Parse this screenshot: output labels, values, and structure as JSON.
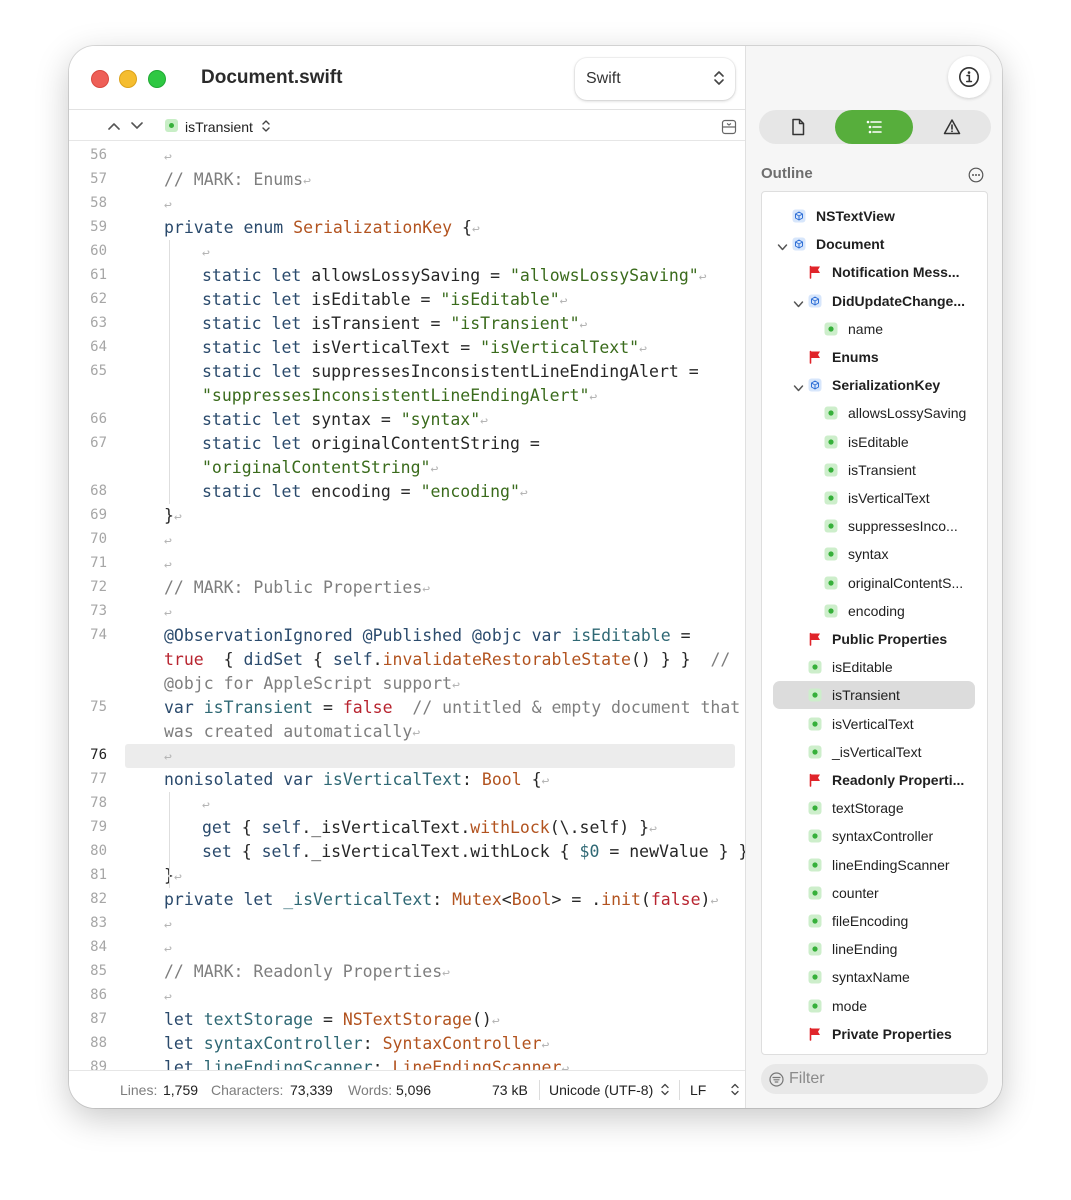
{
  "window": {
    "title": "Document.swift",
    "language": "Swift"
  },
  "jump_bar": {
    "symbol": "isTransient"
  },
  "colors": {
    "keyword": "#2a4a6c",
    "type": "#b2531f",
    "string": "#3a6b1c",
    "comment": "#7e7e7e",
    "member": "#2f6874",
    "literal": "#b8242f",
    "accent": "#57ae3c"
  },
  "code": {
    "current_line": "76",
    "lines": [
      {
        "n": "56",
        "indent": 1,
        "segs": [
          {
            "c": "i",
            "t": "↩"
          }
        ]
      },
      {
        "n": "57",
        "indent": 1,
        "segs": [
          {
            "c": "c",
            "t": "// MARK: Enums"
          },
          {
            "c": "i",
            "t": "↩"
          }
        ]
      },
      {
        "n": "58",
        "indent": 1,
        "segs": [
          {
            "c": "i",
            "t": "↩"
          }
        ]
      },
      {
        "n": "59",
        "indent": 1,
        "segs": [
          {
            "c": "k",
            "t": "private enum "
          },
          {
            "c": "ty",
            "t": "SerializationKey"
          },
          {
            "c": "p",
            "t": " {"
          },
          {
            "c": "i",
            "t": "↩"
          }
        ]
      },
      {
        "n": "60",
        "indent": 2,
        "segs": [
          {
            "c": "i",
            "t": "↩"
          }
        ]
      },
      {
        "n": "61",
        "indent": 2,
        "segs": [
          {
            "c": "k",
            "t": "static let "
          },
          {
            "c": "p",
            "t": "allowsLossySaving = "
          },
          {
            "c": "s",
            "t": "\"allowsLossySaving\""
          },
          {
            "c": "i",
            "t": "↩"
          }
        ]
      },
      {
        "n": "62",
        "indent": 2,
        "segs": [
          {
            "c": "k",
            "t": "static let "
          },
          {
            "c": "p",
            "t": "isEditable = "
          },
          {
            "c": "s",
            "t": "\"isEditable\""
          },
          {
            "c": "i",
            "t": "↩"
          }
        ]
      },
      {
        "n": "63",
        "indent": 2,
        "segs": [
          {
            "c": "k",
            "t": "static let "
          },
          {
            "c": "p",
            "t": "isTransient = "
          },
          {
            "c": "s",
            "t": "\"isTransient\""
          },
          {
            "c": "i",
            "t": "↩"
          }
        ]
      },
      {
        "n": "64",
        "indent": 2,
        "segs": [
          {
            "c": "k",
            "t": "static let "
          },
          {
            "c": "p",
            "t": "isVerticalText = "
          },
          {
            "c": "s",
            "t": "\"isVerticalText\""
          },
          {
            "c": "i",
            "t": "↩"
          }
        ]
      },
      {
        "n": "65",
        "indent": 2,
        "segs": [
          {
            "c": "k",
            "t": "static let "
          },
          {
            "c": "p",
            "t": "suppressesInconsistentLineEndingAlert ="
          }
        ]
      },
      {
        "n": "",
        "indent": 2,
        "segs": [
          {
            "c": "s",
            "t": "\"suppressesInconsistentLineEndingAlert\""
          },
          {
            "c": "i",
            "t": "↩"
          }
        ]
      },
      {
        "n": "66",
        "indent": 2,
        "segs": [
          {
            "c": "k",
            "t": "static let "
          },
          {
            "c": "p",
            "t": "syntax = "
          },
          {
            "c": "s",
            "t": "\"syntax\""
          },
          {
            "c": "i",
            "t": "↩"
          }
        ]
      },
      {
        "n": "67",
        "indent": 2,
        "segs": [
          {
            "c": "k",
            "t": "static let "
          },
          {
            "c": "p",
            "t": "originalContentString ="
          }
        ]
      },
      {
        "n": "",
        "indent": 2,
        "segs": [
          {
            "c": "s",
            "t": "\"originalContentString\""
          },
          {
            "c": "i",
            "t": "↩"
          }
        ]
      },
      {
        "n": "68",
        "indent": 2,
        "segs": [
          {
            "c": "k",
            "t": "static let "
          },
          {
            "c": "p",
            "t": "encoding = "
          },
          {
            "c": "s",
            "t": "\"encoding\""
          },
          {
            "c": "i",
            "t": "↩"
          }
        ]
      },
      {
        "n": "69",
        "indent": 1,
        "segs": [
          {
            "c": "p",
            "t": "}"
          },
          {
            "c": "i",
            "t": "↩"
          }
        ]
      },
      {
        "n": "70",
        "indent": 1,
        "segs": [
          {
            "c": "i",
            "t": "↩"
          }
        ]
      },
      {
        "n": "71",
        "indent": 1,
        "segs": [
          {
            "c": "i",
            "t": "↩"
          }
        ]
      },
      {
        "n": "72",
        "indent": 1,
        "segs": [
          {
            "c": "c",
            "t": "// MARK: Public Properties"
          },
          {
            "c": "i",
            "t": "↩"
          }
        ]
      },
      {
        "n": "73",
        "indent": 1,
        "segs": [
          {
            "c": "i",
            "t": "↩"
          }
        ]
      },
      {
        "n": "74",
        "indent": 1,
        "segs": [
          {
            "c": "a",
            "t": "@ObservationIgnored @Published @objc "
          },
          {
            "c": "k",
            "t": "var "
          },
          {
            "c": "m",
            "t": "isEditable"
          },
          {
            "c": "p",
            "t": " ="
          }
        ]
      },
      {
        "n": "",
        "indent": 1,
        "segs": [
          {
            "c": "l",
            "t": "true"
          },
          {
            "c": "p",
            "t": "  { "
          },
          {
            "c": "k",
            "t": "didSet"
          },
          {
            "c": "p",
            "t": " { "
          },
          {
            "c": "k",
            "t": "self"
          },
          {
            "c": "p",
            "t": "."
          },
          {
            "c": "f",
            "t": "invalidateRestorableState"
          },
          {
            "c": "p",
            "t": "() } }  "
          },
          {
            "c": "c",
            "t": "//"
          }
        ]
      },
      {
        "n": "",
        "indent": 1,
        "segs": [
          {
            "c": "c",
            "t": "@objc for AppleScript support"
          },
          {
            "c": "i",
            "t": "↩"
          }
        ]
      },
      {
        "n": "75",
        "indent": 1,
        "segs": [
          {
            "c": "k",
            "t": "var "
          },
          {
            "c": "m",
            "t": "isTransient"
          },
          {
            "c": "p",
            "t": " = "
          },
          {
            "c": "l",
            "t": "false"
          },
          {
            "c": "c",
            "t": "  // untitled & empty document that"
          }
        ]
      },
      {
        "n": "",
        "indent": 1,
        "segs": [
          {
            "c": "c",
            "t": "was created automatically"
          },
          {
            "c": "i",
            "t": "↩"
          }
        ]
      },
      {
        "n": "76",
        "indent": 1,
        "segs": [
          {
            "c": "i",
            "t": "↩"
          }
        ]
      },
      {
        "n": "77",
        "indent": 1,
        "segs": [
          {
            "c": "k",
            "t": "nonisolated var "
          },
          {
            "c": "m",
            "t": "isVerticalText"
          },
          {
            "c": "p",
            "t": ": "
          },
          {
            "c": "ty",
            "t": "Bool"
          },
          {
            "c": "p",
            "t": " {"
          },
          {
            "c": "i",
            "t": "↩"
          }
        ]
      },
      {
        "n": "78",
        "indent": 2,
        "segs": [
          {
            "c": "i",
            "t": "↩"
          }
        ]
      },
      {
        "n": "79",
        "indent": 2,
        "segs": [
          {
            "c": "k",
            "t": "get"
          },
          {
            "c": "p",
            "t": " { "
          },
          {
            "c": "k",
            "t": "self"
          },
          {
            "c": "p",
            "t": "._isVerticalText."
          },
          {
            "c": "f",
            "t": "withLock"
          },
          {
            "c": "p",
            "t": "(\\.self) }"
          },
          {
            "c": "i",
            "t": "↩"
          }
        ]
      },
      {
        "n": "80",
        "indent": 2,
        "segs": [
          {
            "c": "k",
            "t": "set"
          },
          {
            "c": "p",
            "t": " { "
          },
          {
            "c": "k",
            "t": "self"
          },
          {
            "c": "p",
            "t": "._isVerticalText.withLock { "
          },
          {
            "c": "m",
            "t": "$0"
          },
          {
            "c": "p",
            "t": " = newValue } }"
          },
          {
            "c": "i",
            "t": "↩"
          }
        ]
      },
      {
        "n": "81",
        "indent": 1,
        "segs": [
          {
            "c": "p",
            "t": "}"
          },
          {
            "c": "i",
            "t": "↩"
          }
        ]
      },
      {
        "n": "82",
        "indent": 1,
        "segs": [
          {
            "c": "k",
            "t": "private let "
          },
          {
            "c": "m",
            "t": "_isVerticalText"
          },
          {
            "c": "p",
            "t": ": "
          },
          {
            "c": "ty",
            "t": "Mutex"
          },
          {
            "c": "p",
            "t": "<"
          },
          {
            "c": "ty",
            "t": "Bool"
          },
          {
            "c": "p",
            "t": "> = ."
          },
          {
            "c": "f",
            "t": "init"
          },
          {
            "c": "p",
            "t": "("
          },
          {
            "c": "l",
            "t": "false"
          },
          {
            "c": "p",
            "t": ")"
          },
          {
            "c": "i",
            "t": "↩"
          }
        ]
      },
      {
        "n": "83",
        "indent": 1,
        "segs": [
          {
            "c": "i",
            "t": "↩"
          }
        ]
      },
      {
        "n": "84",
        "indent": 1,
        "segs": [
          {
            "c": "i",
            "t": "↩"
          }
        ]
      },
      {
        "n": "85",
        "indent": 1,
        "segs": [
          {
            "c": "c",
            "t": "// MARK: Readonly Properties"
          },
          {
            "c": "i",
            "t": "↩"
          }
        ]
      },
      {
        "n": "86",
        "indent": 1,
        "segs": [
          {
            "c": "i",
            "t": "↩"
          }
        ]
      },
      {
        "n": "87",
        "indent": 1,
        "segs": [
          {
            "c": "k",
            "t": "let "
          },
          {
            "c": "m",
            "t": "textStorage"
          },
          {
            "c": "p",
            "t": " = "
          },
          {
            "c": "ty",
            "t": "NSTextStorage"
          },
          {
            "c": "p",
            "t": "()"
          },
          {
            "c": "i",
            "t": "↩"
          }
        ]
      },
      {
        "n": "88",
        "indent": 1,
        "segs": [
          {
            "c": "k",
            "t": "let "
          },
          {
            "c": "m",
            "t": "syntaxController"
          },
          {
            "c": "p",
            "t": ": "
          },
          {
            "c": "ty",
            "t": "SyntaxController"
          },
          {
            "c": "i",
            "t": "↩"
          }
        ]
      },
      {
        "n": "89",
        "indent": 1,
        "segs": [
          {
            "c": "k",
            "t": "let "
          },
          {
            "c": "m",
            "t": "lineEndingScanner"
          },
          {
            "c": "p",
            "t": ": "
          },
          {
            "c": "ty",
            "t": "LineEndingScanner"
          },
          {
            "c": "i",
            "t": "↩"
          }
        ]
      }
    ]
  },
  "status_bar": {
    "lines_label": "Lines:",
    "lines_value": "1,759",
    "chars_label": "Characters:",
    "chars_value": "73,339",
    "words_label": "Words:",
    "words_value": "5,096",
    "size": "73 kB",
    "encoding": "Unicode (UTF-8)",
    "line_ending": "LF"
  },
  "inspector": {
    "outline_title": "Outline",
    "filter_placeholder": "Filter",
    "items": [
      {
        "label": "NSTextView",
        "kind": "class",
        "level": 1,
        "bold": true,
        "toggle": ""
      },
      {
        "label": "Document",
        "kind": "class",
        "level": 1,
        "bold": true,
        "toggle": "open"
      },
      {
        "label": "Notification Mess...",
        "kind": "mark",
        "level": 2,
        "bold": true,
        "toggle": ""
      },
      {
        "label": "DidUpdateChange...",
        "kind": "class",
        "level": 2,
        "bold": true,
        "toggle": "open"
      },
      {
        "label": "name",
        "kind": "property",
        "level": 3,
        "bold": false,
        "toggle": ""
      },
      {
        "label": "Enums",
        "kind": "mark",
        "level": 2,
        "bold": true,
        "toggle": ""
      },
      {
        "label": "SerializationKey",
        "kind": "class",
        "level": 2,
        "bold": true,
        "toggle": "open"
      },
      {
        "label": "allowsLossySaving",
        "kind": "property",
        "level": 3,
        "bold": false,
        "toggle": ""
      },
      {
        "label": "isEditable",
        "kind": "property",
        "level": 3,
        "bold": false,
        "toggle": ""
      },
      {
        "label": "isTransient",
        "kind": "property",
        "level": 3,
        "bold": false,
        "toggle": ""
      },
      {
        "label": "isVerticalText",
        "kind": "property",
        "level": 3,
        "bold": false,
        "toggle": ""
      },
      {
        "label": "suppressesInco...",
        "kind": "property",
        "level": 3,
        "bold": false,
        "toggle": ""
      },
      {
        "label": "syntax",
        "kind": "property",
        "level": 3,
        "bold": false,
        "toggle": ""
      },
      {
        "label": "originalContentS...",
        "kind": "property",
        "level": 3,
        "bold": false,
        "toggle": ""
      },
      {
        "label": "encoding",
        "kind": "property",
        "level": 3,
        "bold": false,
        "toggle": ""
      },
      {
        "label": "Public Properties",
        "kind": "mark",
        "level": 2,
        "bold": true,
        "toggle": ""
      },
      {
        "label": "isEditable",
        "kind": "property",
        "level": 2,
        "bold": false,
        "toggle": ""
      },
      {
        "label": "isTransient",
        "kind": "property",
        "level": 2,
        "bold": false,
        "toggle": "",
        "selected": true
      },
      {
        "label": "isVerticalText",
        "kind": "property",
        "level": 2,
        "bold": false,
        "toggle": ""
      },
      {
        "label": "_isVerticalText",
        "kind": "property",
        "level": 2,
        "bold": false,
        "toggle": ""
      },
      {
        "label": "Readonly Properti...",
        "kind": "mark",
        "level": 2,
        "bold": true,
        "toggle": ""
      },
      {
        "label": "textStorage",
        "kind": "property",
        "level": 2,
        "bold": false,
        "toggle": ""
      },
      {
        "label": "syntaxController",
        "kind": "property",
        "level": 2,
        "bold": false,
        "toggle": ""
      },
      {
        "label": "lineEndingScanner",
        "kind": "property",
        "level": 2,
        "bold": false,
        "toggle": ""
      },
      {
        "label": "counter",
        "kind": "property",
        "level": 2,
        "bold": false,
        "toggle": ""
      },
      {
        "label": "fileEncoding",
        "kind": "property",
        "level": 2,
        "bold": false,
        "toggle": ""
      },
      {
        "label": "lineEnding",
        "kind": "property",
        "level": 2,
        "bold": false,
        "toggle": ""
      },
      {
        "label": "syntaxName",
        "kind": "property",
        "level": 2,
        "bold": false,
        "toggle": ""
      },
      {
        "label": "mode",
        "kind": "property",
        "level": 2,
        "bold": false,
        "toggle": ""
      },
      {
        "label": "Private Properties",
        "kind": "mark",
        "level": 2,
        "bold": true,
        "toggle": ""
      }
    ]
  }
}
